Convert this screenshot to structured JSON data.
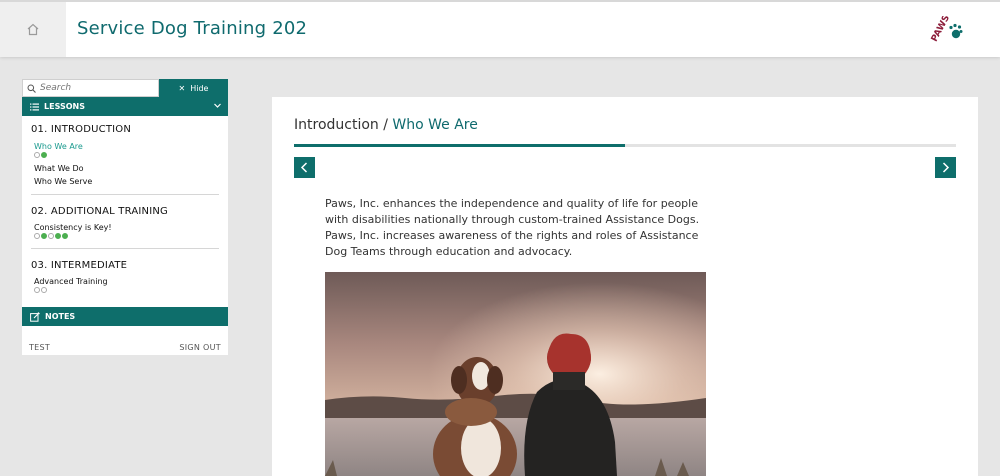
{
  "header": {
    "course_title": "Service Dog Training 202",
    "logo_text": "PAWS"
  },
  "sidebar": {
    "search_placeholder": "Search",
    "hide_label": "Hide",
    "lessons_label": "LESSONS",
    "sections": [
      {
        "title": "01. INTRODUCTION",
        "items": [
          {
            "label": "Who We Are",
            "active": true,
            "progress": [
              "incomplete",
              "complete"
            ]
          },
          {
            "label": "What We Do"
          },
          {
            "label": "Who We Serve"
          }
        ]
      },
      {
        "title": "02. ADDITIONAL TRAINING",
        "items": [
          {
            "label": "Consistency is Key!",
            "progress": [
              "incomplete",
              "complete",
              "incomplete",
              "complete",
              "complete"
            ]
          }
        ]
      },
      {
        "title": "03. INTERMEDIATE",
        "items": [
          {
            "label": "Advanced Training",
            "progress": [
              "incomplete",
              "incomplete"
            ]
          }
        ]
      }
    ],
    "notes_label": "NOTES",
    "footer_user": "TEST",
    "footer_signout": "SIGN OUT"
  },
  "content": {
    "breadcrumb_parent": "Introduction",
    "breadcrumb_separator": " / ",
    "breadcrumb_current": "Who We Are",
    "progress_percent": 50,
    "paragraph": "Paws, Inc. enhances the independence and quality of life for people with disabilities nationally through custom-trained Assistance Dogs. Paws, Inc. increases awareness of the rights and roles of Assistance Dog Teams through education and advocacy.",
    "image_alt": "Woman with red hair sitting beside a dog by a lake at sunset"
  },
  "colors": {
    "accent": "#0e6e6b",
    "title_teal": "#0f6a6e",
    "active_item": "#1a9a8e",
    "progress_done": "#4caf50"
  }
}
